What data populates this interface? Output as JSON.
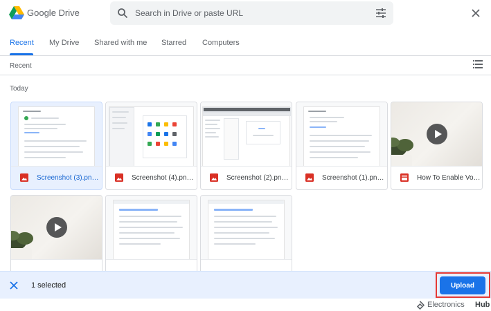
{
  "header": {
    "app_title": "Google Drive",
    "search_placeholder": "Search in Drive or paste URL"
  },
  "tabs": [
    {
      "label": "Recent",
      "active": true
    },
    {
      "label": "My Drive",
      "active": false
    },
    {
      "label": "Shared with me",
      "active": false
    },
    {
      "label": "Starred",
      "active": false
    },
    {
      "label": "Computers",
      "active": false
    }
  ],
  "breadcrumb": "Recent",
  "group_label": "Today",
  "files": [
    {
      "name": "Screenshot (3).png...",
      "type": "image",
      "selected": true
    },
    {
      "name": "Screenshot (4).png...",
      "type": "image",
      "selected": false
    },
    {
      "name": "Screenshot (2).png...",
      "type": "image",
      "selected": false
    },
    {
      "name": "Screenshot (1).png...",
      "type": "image",
      "selected": false
    },
    {
      "name": "How To Enable Voi...",
      "type": "video",
      "selected": false
    },
    {
      "name": "",
      "type": "video",
      "selected": false
    },
    {
      "name": "",
      "type": "document",
      "selected": false
    },
    {
      "name": "",
      "type": "document",
      "selected": false
    }
  ],
  "selection_bar": {
    "count_text": "1 selected",
    "upload_label": "Upload"
  },
  "watermark": {
    "part1": "Electronics",
    "part2": "Hub"
  },
  "colors": {
    "accent": "#1a73e8",
    "image_type": "#d93025",
    "highlight": "#e53935",
    "selection_bg": "#e8f0fe"
  }
}
